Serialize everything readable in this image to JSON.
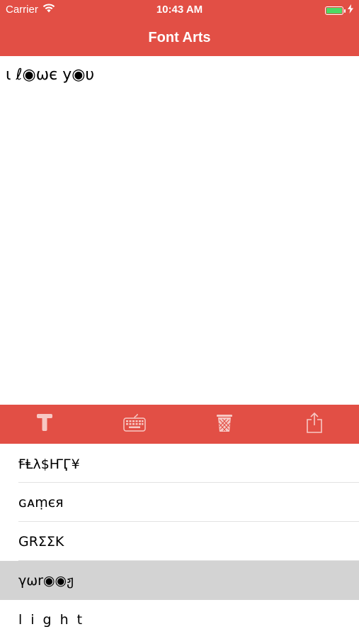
{
  "status": {
    "carrier": "Carrier",
    "time": "10:43 AM"
  },
  "nav": {
    "title": "Font Arts"
  },
  "editor": {
    "text": "ι ℓ◉ωє у◉υ"
  },
  "toolbar": {
    "icons": [
      "text-format-icon",
      "keyboard-icon",
      "trash-icon",
      "share-icon"
    ]
  },
  "styles": [
    {
      "label": "ꞘⱠλ$ҤӶ¥",
      "selected": false
    },
    {
      "label": "ɢᴀṃєя",
      "selected": false
    },
    {
      "label": "GRΣΣK",
      "selected": false
    },
    {
      "label": "γωr◉◉ჟ",
      "selected": true
    },
    {
      "label": "light",
      "selected": false
    }
  ],
  "colors": {
    "accent": "#E24F45",
    "selected_row": "#D3D3D3",
    "battery": "#4CD964"
  }
}
